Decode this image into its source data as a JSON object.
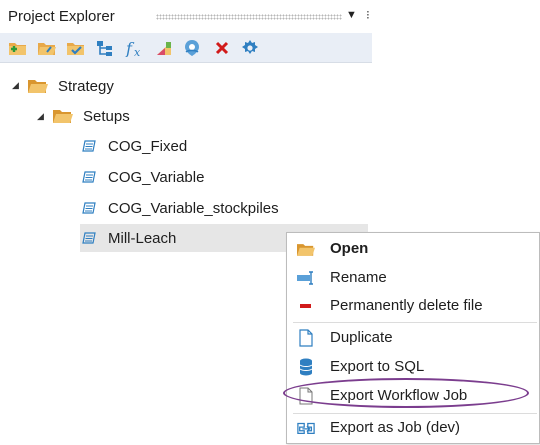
{
  "panel": {
    "title": "Project Explorer",
    "toolbar": [
      {
        "name": "new-folder-icon"
      },
      {
        "name": "open-folder-icon"
      },
      {
        "name": "folder-check-icon"
      },
      {
        "name": "hierarchy-icon"
      },
      {
        "name": "function-icon"
      },
      {
        "name": "chart-icon"
      },
      {
        "name": "location-icon"
      },
      {
        "name": "delete-icon"
      },
      {
        "name": "settings-icon"
      }
    ]
  },
  "tree": {
    "root": {
      "label": "Strategy"
    },
    "child": {
      "label": "Setups"
    },
    "items": [
      {
        "label": "COG_Fixed"
      },
      {
        "label": "COG_Variable"
      },
      {
        "label": "COG_Variable_stockpiles"
      },
      {
        "label": "Mill-Leach"
      }
    ]
  },
  "menu": {
    "items": [
      {
        "label": "Open",
        "icon": "folder-open-icon"
      },
      {
        "label": "Rename",
        "icon": "rename-icon"
      },
      {
        "label": "Permanently delete file",
        "icon": "delete-file-icon"
      },
      {
        "label": "Duplicate",
        "icon": "duplicate-icon"
      },
      {
        "label": "Export to SQL",
        "icon": "database-icon"
      },
      {
        "label": "Export Workflow Job",
        "icon": "document-icon"
      },
      {
        "label": "Export as Job (dev)",
        "icon": "export-job-icon"
      }
    ]
  },
  "colors": {
    "folder": "#e8a94a",
    "toolbar_bg": "#e9eef6",
    "icon_blue": "#2f7fc1",
    "delete_red": "#d11a1a",
    "highlight": "#7b3d8e"
  }
}
